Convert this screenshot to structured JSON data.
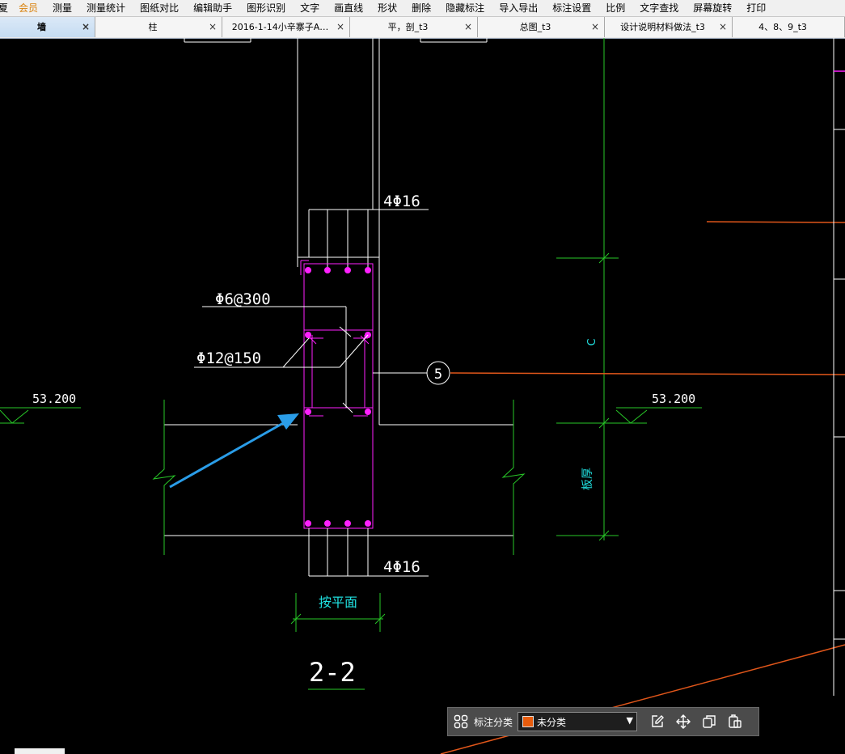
{
  "menubar": {
    "items": [
      "夏",
      "会员",
      "测量",
      "测量统计",
      "图纸对比",
      "编辑助手",
      "图形识别",
      "文字",
      "画直线",
      "形状",
      "删除",
      "隐藏标注",
      "导入导出",
      "标注设置",
      "比例",
      "文字查找",
      "屏幕旋转",
      "打印"
    ]
  },
  "tabs": [
    {
      "label": "墙",
      "active": true
    },
    {
      "label": "柱"
    },
    {
      "label": "2016-1-14小辛寨子A…"
    },
    {
      "label": "平，剖_t3"
    },
    {
      "label": "总图_t3"
    },
    {
      "label": "设计说明材料做法_t3"
    },
    {
      "label": "4、8、9_t3"
    }
  ],
  "tab_close_glyph": "×",
  "drawing": {
    "rebar_top": "4Φ16",
    "stirrup": "Φ6@300",
    "tie_bar": "Φ12@150",
    "grid_bubble": "5",
    "elev_left": "53.200",
    "elev_right": "53.200",
    "dim_c": "C",
    "dim_slab": "板厚",
    "rebar_bottom": "4Φ16",
    "dim_width": "按平面",
    "section_title": "2-2"
  },
  "annotation_toolbar": {
    "label": "标注分类",
    "selected": "未分类",
    "swatch_color": "#e85c0d"
  },
  "colors": {
    "magenta": "#ff20ff",
    "green": "#28c828",
    "cyan": "#20e0e0",
    "orange": "#e0561a",
    "white": "#ffffff",
    "arrow": "#2a9de8"
  }
}
